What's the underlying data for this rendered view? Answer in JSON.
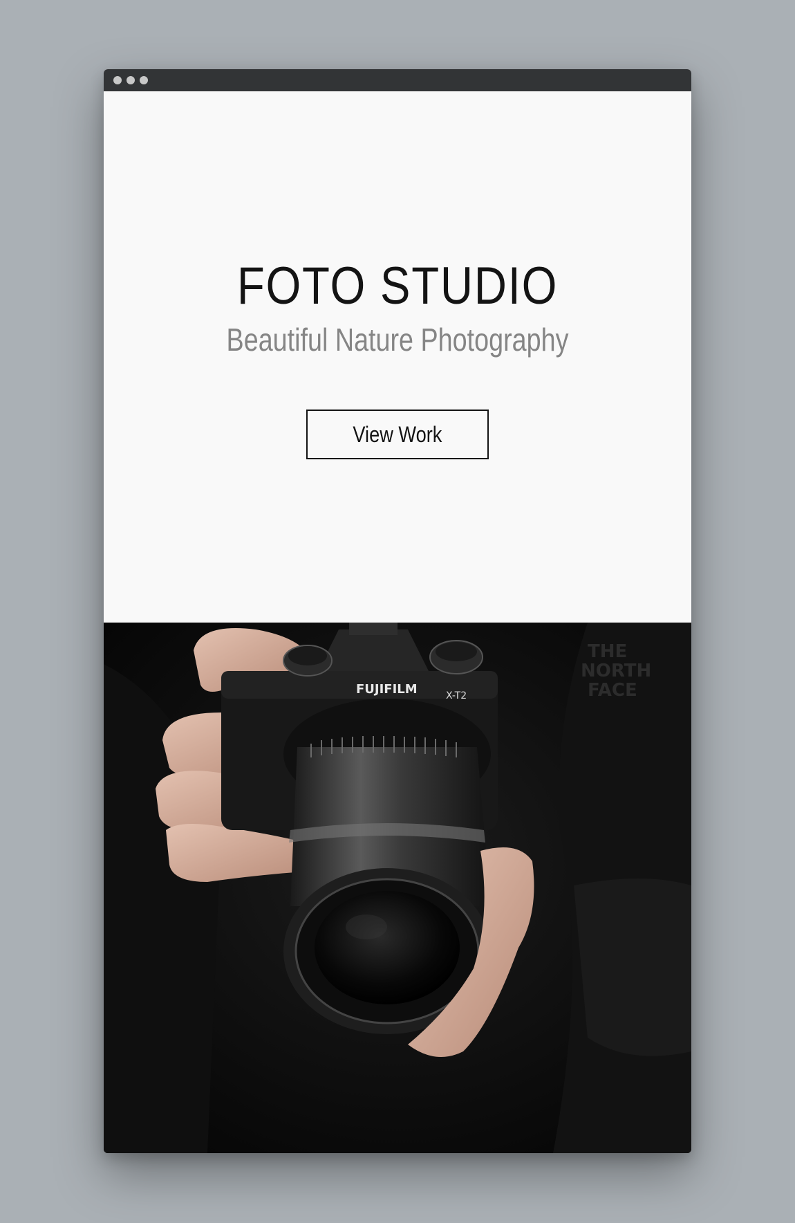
{
  "window": {
    "controls": [
      "close",
      "minimize",
      "maximize"
    ]
  },
  "hero": {
    "title": "FOTO STUDIO",
    "subtitle": "Beautiful Nature Photography",
    "cta_label": "View Work"
  },
  "photo": {
    "brand_text": "FUJIFILM",
    "model_text": "X-T2",
    "description": "camera-held-in-hands"
  },
  "colors": {
    "page_background": "#aab0b5",
    "titlebar": "#323436",
    "hero_background": "#f9f9f9",
    "title_text": "#141414",
    "subtitle_text": "#858585"
  }
}
